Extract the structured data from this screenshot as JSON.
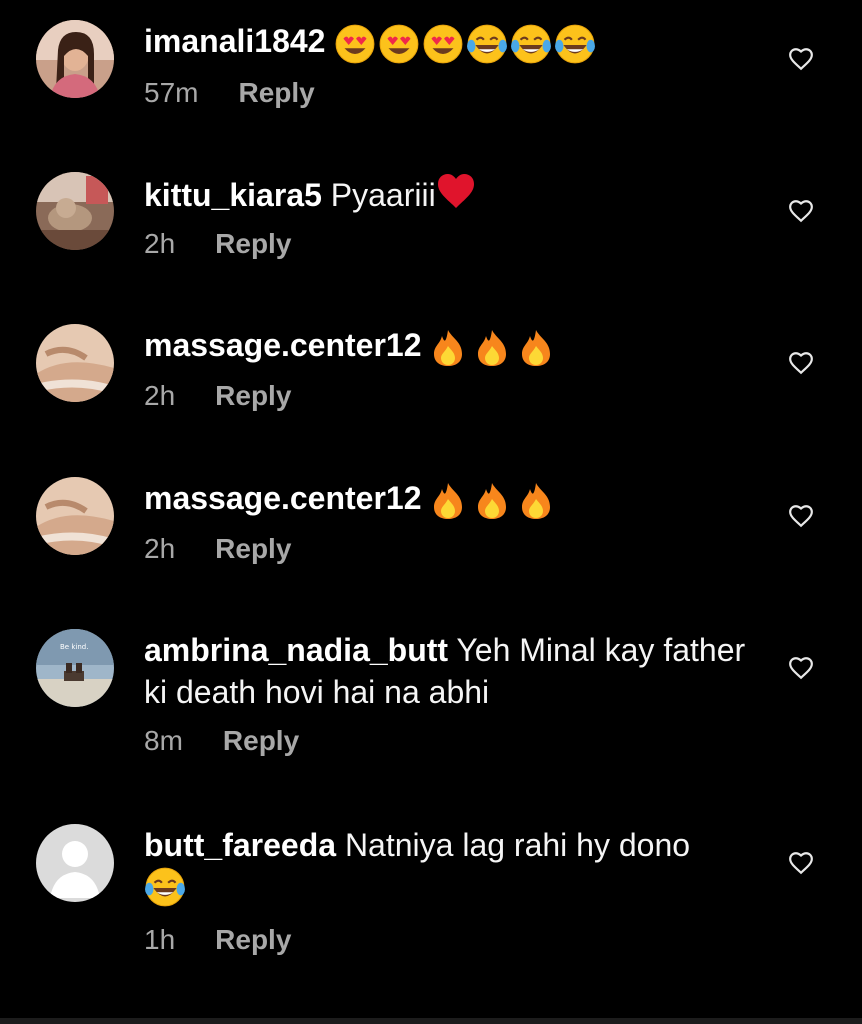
{
  "comments": [
    {
      "username": "imanali1842",
      "text": "",
      "emojis": [
        "heart-eyes",
        "heart-eyes",
        "heart-eyes",
        "tears-of-joy",
        "tears-of-joy",
        "tears-of-joy"
      ],
      "time": "57m",
      "reply": "Reply",
      "avatar": "woman-portrait"
    },
    {
      "username": "kittu_kiara5",
      "text": "Pyaariii",
      "emojis": [
        "red-heart"
      ],
      "time": "2h",
      "reply": "Reply",
      "avatar": "cat-photo"
    },
    {
      "username": "massage.center12",
      "text": "",
      "emojis": [
        "fire",
        "fire",
        "fire"
      ],
      "time": "2h",
      "reply": "Reply",
      "avatar": "massage-photo"
    },
    {
      "username": "massage.center12",
      "text": "",
      "emojis": [
        "fire",
        "fire",
        "fire"
      ],
      "time": "2h",
      "reply": "Reply",
      "avatar": "massage-photo"
    },
    {
      "username": "ambrina_nadia_butt",
      "text": "Yeh Minal kay father ki death hovi hai na abhi",
      "emojis": [],
      "time": "8m",
      "reply": "Reply",
      "avatar": "be-kind-photo"
    },
    {
      "username": "butt_fareeda",
      "text": "Natniya lag rahi hy dono",
      "emojis": [
        "tears-of-joy"
      ],
      "time": "1h",
      "reply": "Reply",
      "avatar": "default-avatar"
    }
  ],
  "avatar_caption": "Be kind.",
  "colors": {
    "background": "#000000",
    "meta": "#a8a8a8",
    "text": "#f5f5f5"
  }
}
